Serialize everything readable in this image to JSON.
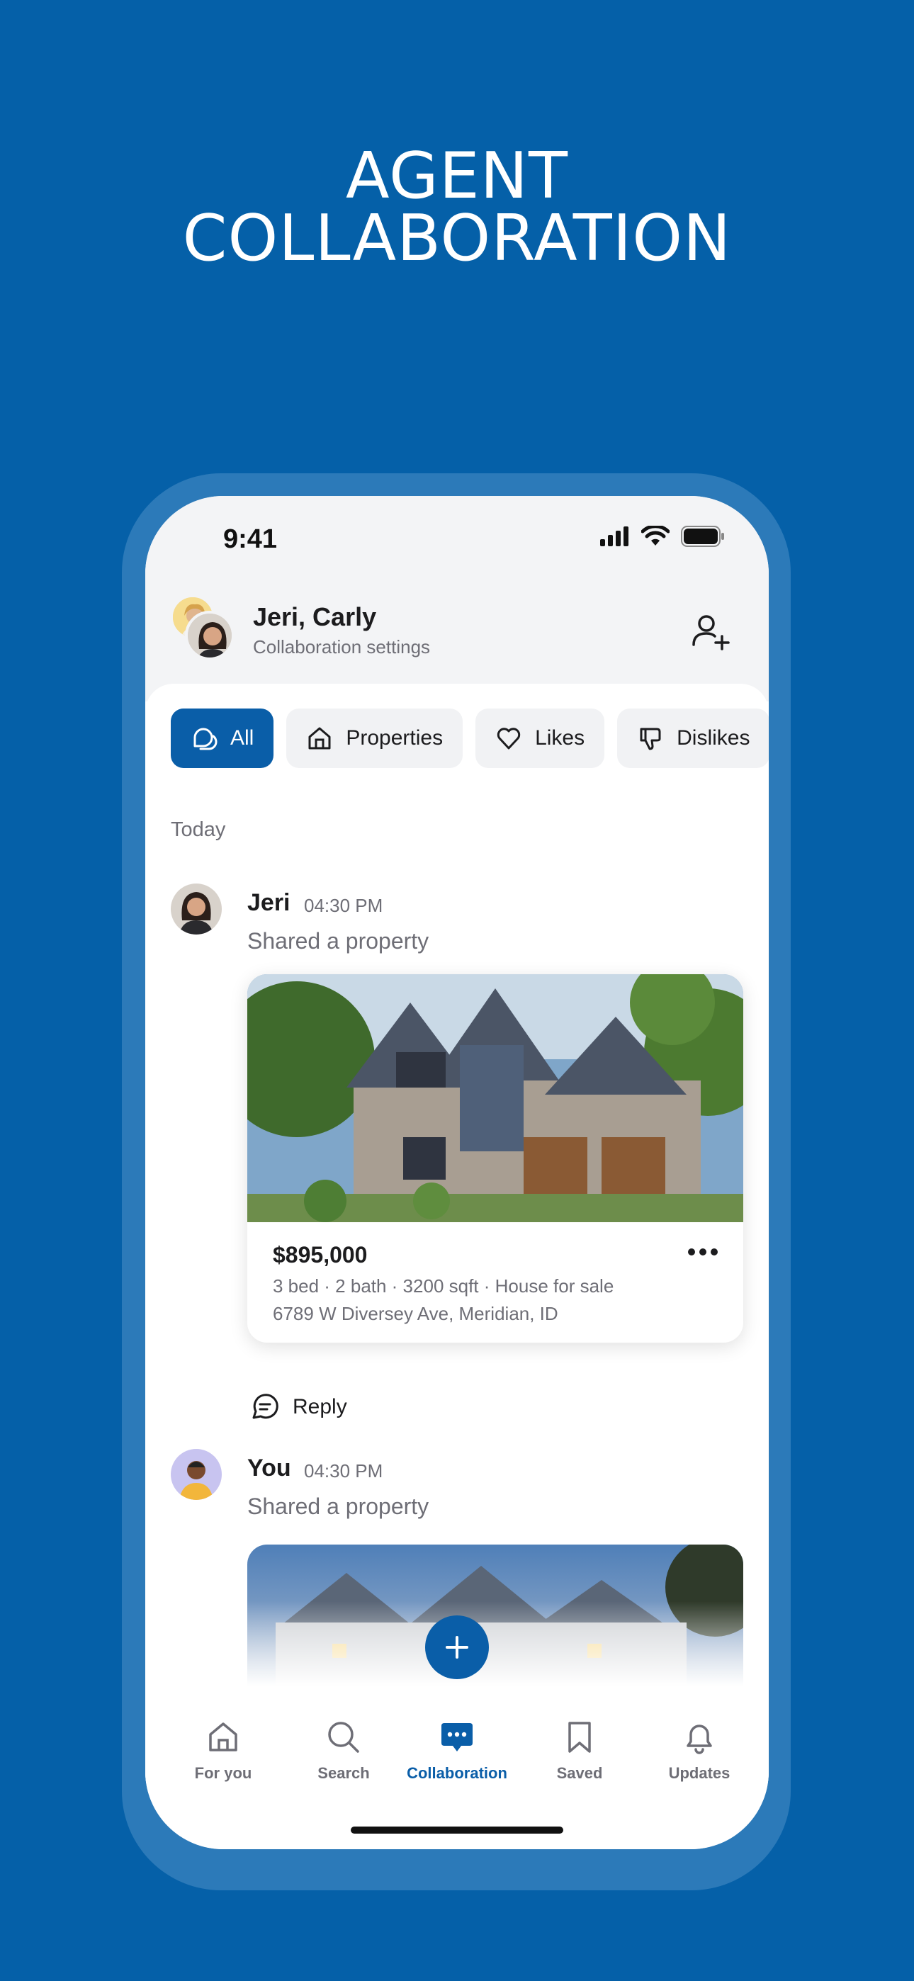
{
  "headline": {
    "line1": "AGENT",
    "line2": "COLLABORATION"
  },
  "status_bar": {
    "time": "9:41"
  },
  "header": {
    "names": "Jeri, Carly",
    "subtitle": "Collaboration settings"
  },
  "filters": [
    {
      "label": "All",
      "icon": "chat-bubbles-icon",
      "active": true
    },
    {
      "label": "Properties",
      "icon": "house-icon",
      "active": false
    },
    {
      "label": "Likes",
      "icon": "heart-icon",
      "active": false
    },
    {
      "label": "Dislikes",
      "icon": "thumbs-down-icon",
      "active": false
    }
  ],
  "feed": {
    "day_label": "Today",
    "messages": [
      {
        "author": "Jeri",
        "time": "04:30 PM",
        "text": "Shared a property",
        "property": {
          "price": "$895,000",
          "details": "3 bed · 2 bath · 3200 sqft · House for sale",
          "address": "6789 W Diversey Ave, Meridian, ID"
        },
        "reply_label": "Reply"
      },
      {
        "author": "You",
        "time": "04:30 PM",
        "text": "Shared a property"
      }
    ]
  },
  "tabbar": [
    {
      "label": "For you",
      "icon": "home-icon"
    },
    {
      "label": "Search",
      "icon": "search-icon"
    },
    {
      "label": "Collaboration",
      "icon": "chat-icon",
      "active": true
    },
    {
      "label": "Saved",
      "icon": "bookmark-icon"
    },
    {
      "label": "Updates",
      "icon": "bell-icon"
    }
  ],
  "colors": {
    "brand": "#0A5EA8",
    "background": "#0560A8",
    "muted_text": "#6E6E76"
  }
}
